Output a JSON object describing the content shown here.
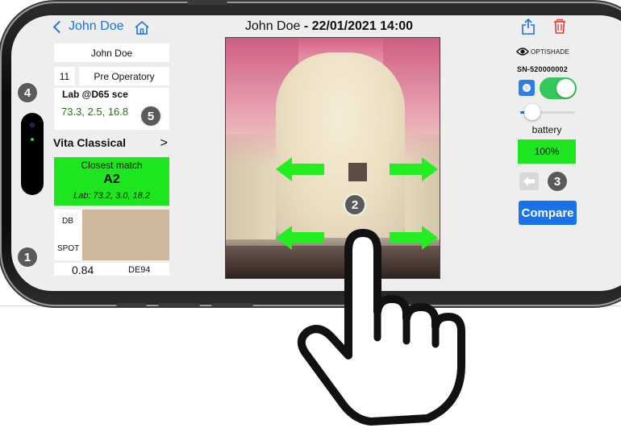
{
  "nav": {
    "back_label": "John Doe",
    "title_name": "John Doe",
    "title_datetime": "- 22/01/2021 14:00"
  },
  "patient": {
    "name": "John Doe",
    "tooth_number": "11",
    "phase": "Pre Operatory"
  },
  "lab_panel": {
    "title": "Lab @D65 sce",
    "value": "73.3, 2.5, 16.8"
  },
  "shade_guide": {
    "label": "Vita Classical",
    "chevron": ">"
  },
  "closest_match": {
    "title": "Closest match",
    "shade": "A2",
    "lab": "Lab: 73.2, 3.0, 18.2"
  },
  "comparison": {
    "db_label": "DB",
    "spot_label": "SPOT",
    "delta_value": "0.84",
    "delta_unit": "DE94"
  },
  "device": {
    "brand": "OPTISHADE",
    "serial": "SN-520000002",
    "toggle_on": true,
    "slider_level": 0.1,
    "battery_label": "battery",
    "battery_value": "100%"
  },
  "actions": {
    "compare_label": "Compare"
  },
  "callouts": [
    "1",
    "2",
    "3",
    "4",
    "5"
  ],
  "colors": {
    "accent": "#1a73e8",
    "match_green": "#1ee61e",
    "toggle_green": "#34c759",
    "delete_red": "#e53935",
    "swatch": "#cdb89b",
    "lab_text_green": "#2f6e1e"
  },
  "icons": [
    "back-chevron-icon",
    "home-icon",
    "share-icon",
    "trash-icon",
    "eye-icon",
    "camera-icon",
    "back-arrow-icon",
    "pointing-hand-icon"
  ]
}
